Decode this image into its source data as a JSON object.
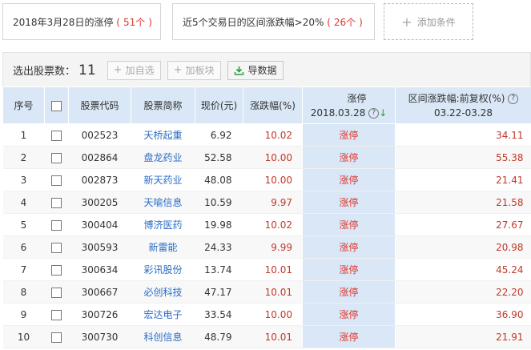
{
  "conditions": [
    {
      "text": "2018年3月28日的涨停",
      "count": "51个"
    },
    {
      "text": "近5个交易日的区间涨跌幅>20%",
      "count": "26个"
    }
  ],
  "add_condition": "添加条件",
  "toolbar": {
    "selected_label": "选出股票数：",
    "selected_count": "11",
    "add_watch": "加自选",
    "add_sector": "加板块",
    "export": "导数据"
  },
  "table": {
    "headers": {
      "index": "序号",
      "code": "股票代码",
      "name": "股票简称",
      "price": "现价(元)",
      "pct": "涨跌幅(%)",
      "limit_up": "涨停",
      "limit_up_date": "2018.03.28",
      "range": "区间涨跌幅:前复权(%)",
      "range_dates": "03.22-03.28"
    },
    "rows": [
      {
        "index": "1",
        "code": "002523",
        "name": "天桥起重",
        "price": "6.92",
        "pct": "10.02",
        "limit_up": "涨停",
        "range": "34.11"
      },
      {
        "index": "2",
        "code": "002864",
        "name": "盘龙药业",
        "price": "52.58",
        "pct": "10.00",
        "limit_up": "涨停",
        "range": "55.38"
      },
      {
        "index": "3",
        "code": "002873",
        "name": "新天药业",
        "price": "48.08",
        "pct": "10.00",
        "limit_up": "涨停",
        "range": "21.41"
      },
      {
        "index": "4",
        "code": "300205",
        "name": "天喻信息",
        "price": "10.59",
        "pct": "9.97",
        "limit_up": "涨停",
        "range": "21.58"
      },
      {
        "index": "5",
        "code": "300404",
        "name": "博济医药",
        "price": "19.98",
        "pct": "10.02",
        "limit_up": "涨停",
        "range": "27.67"
      },
      {
        "index": "6",
        "code": "300593",
        "name": "新雷能",
        "price": "24.33",
        "pct": "9.99",
        "limit_up": "涨停",
        "range": "20.98"
      },
      {
        "index": "7",
        "code": "300634",
        "name": "彩讯股份",
        "price": "13.74",
        "pct": "10.01",
        "limit_up": "涨停",
        "range": "45.24"
      },
      {
        "index": "8",
        "code": "300667",
        "name": "必创科技",
        "price": "47.17",
        "pct": "10.01",
        "limit_up": "涨停",
        "range": "22.20"
      },
      {
        "index": "9",
        "code": "300726",
        "name": "宏达电子",
        "price": "33.54",
        "pct": "10.00",
        "limit_up": "涨停",
        "range": "36.90"
      },
      {
        "index": "10",
        "code": "300730",
        "name": "科创信息",
        "price": "48.79",
        "pct": "10.01",
        "limit_up": "涨停",
        "range": "21.91"
      }
    ]
  },
  "colors": {
    "accent_red": "#e0352b",
    "header_blue": "#d9e7f6",
    "link_blue": "#2b6cc4"
  }
}
